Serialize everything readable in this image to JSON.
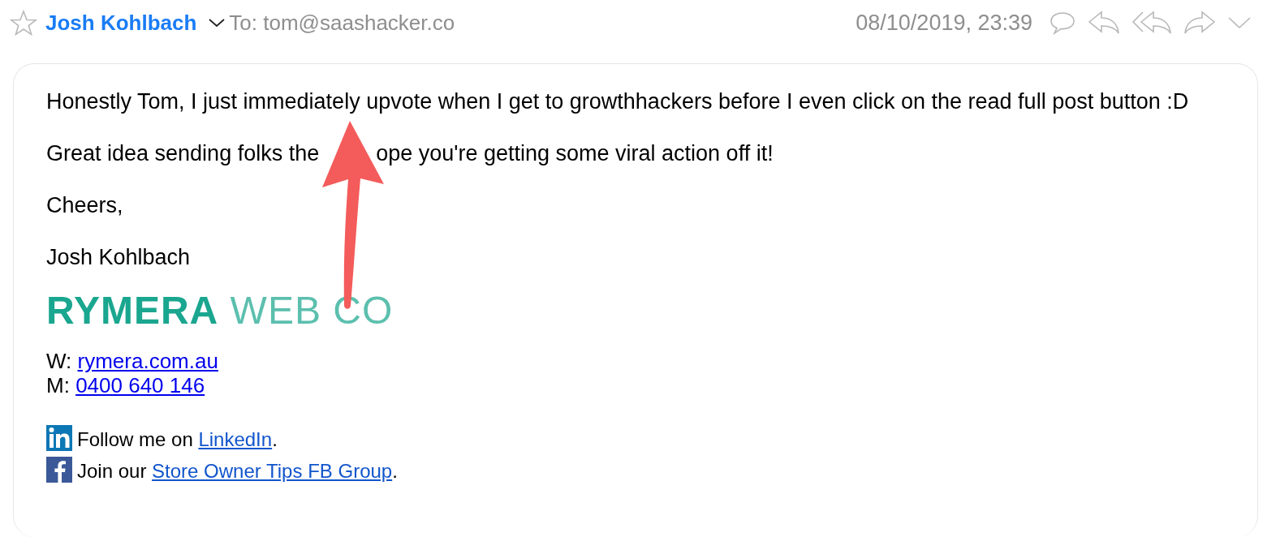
{
  "header": {
    "starred": false,
    "sender": "Josh Kohlbach",
    "to": "To: tom@saashacker.co",
    "date": "08/10/2019, 23:39"
  },
  "message": {
    "paragraphs": [
      {
        "parts": [
          "Honestly Tom, I just immediately upvote when I get to growthhackers before I even click on the read full post button :D"
        ]
      },
      {
        "parts": [
          "Great idea sending folks the",
          "ope you're getting some viral action off it!"
        ]
      },
      {
        "parts": [
          "Cheers,"
        ]
      },
      {
        "parts": [
          "Josh Kohlbach"
        ]
      }
    ],
    "logo": {
      "bold": "RYMERA",
      "light": "WEB CO"
    },
    "contact": [
      {
        "label": "W:",
        "link": "rymera.com.au"
      },
      {
        "label": "M:",
        "link": "0400 640 146"
      }
    ],
    "social": [
      {
        "kind": "linkedin",
        "before": "Follow me on ",
        "link": "LinkedIn",
        "after": "."
      },
      {
        "kind": "facebook",
        "before": "Join our ",
        "link": "Store Owner Tips FB Group",
        "after": "."
      }
    ]
  }
}
